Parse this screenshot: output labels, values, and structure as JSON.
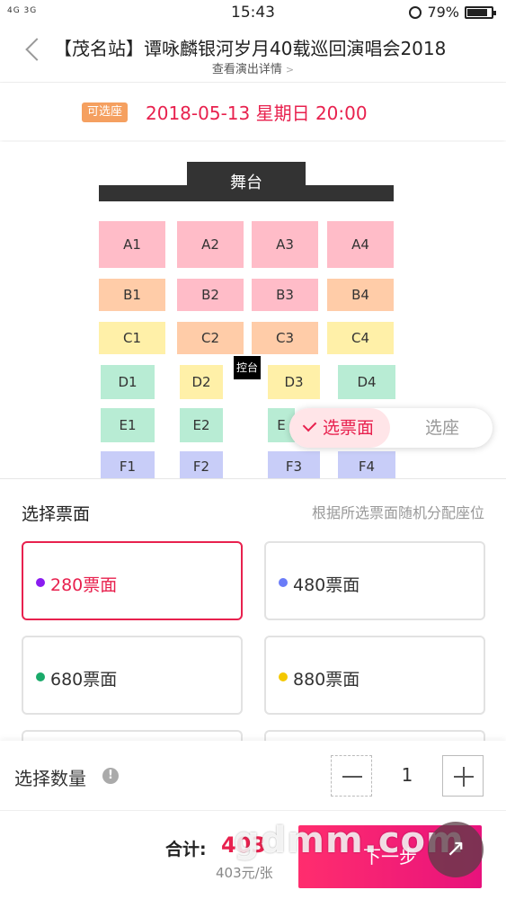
{
  "status_bar": {
    "signal": "4G 3G",
    "time": "15:43",
    "battery": "79%",
    "battery_level": 0.79
  },
  "header": {
    "title": "【茂名站】谭咏麟银河岁月40载巡回演唱会2018",
    "subtitle": "查看演出详情",
    "subtitle_chevron": ">"
  },
  "session": {
    "tag": "可选座",
    "date": "2018-05-13 星期日 20:00"
  },
  "seat_map": {
    "stage": "舞台",
    "control": "控台",
    "sections": [
      {
        "label": "A1",
        "color": "#ffbcc8"
      },
      {
        "label": "A2",
        "color": "#ffbcc8"
      },
      {
        "label": "A3",
        "color": "#ffbcc8"
      },
      {
        "label": "A4",
        "color": "#ffbcc8"
      },
      {
        "label": "B1",
        "color": "#ffcca8"
      },
      {
        "label": "B2",
        "color": "#ffbcc8"
      },
      {
        "label": "B3",
        "color": "#ffbcc8"
      },
      {
        "label": "B4",
        "color": "#ffcca8"
      },
      {
        "label": "C1",
        "color": "#fff0a8"
      },
      {
        "label": "C2",
        "color": "#ffcca8"
      },
      {
        "label": "C3",
        "color": "#ffcca8"
      },
      {
        "label": "C4",
        "color": "#fff0a8"
      },
      {
        "label": "D1",
        "color": "#b8ecd4"
      },
      {
        "label": "D2",
        "color": "#fff0a8"
      },
      {
        "label": "D3",
        "color": "#fff0a8"
      },
      {
        "label": "D4",
        "color": "#b8ecd4"
      },
      {
        "label": "E1",
        "color": "#b8ecd4"
      },
      {
        "label": "E2",
        "color": "#b8ecd4"
      },
      {
        "label": "E",
        "color": "#b8ecd4"
      },
      {
        "label": "F1",
        "color": "#c8cdf8"
      },
      {
        "label": "F2",
        "color": "#c8cdf8"
      },
      {
        "label": "F3",
        "color": "#c8cdf8"
      },
      {
        "label": "F4",
        "color": "#c8cdf8"
      }
    ]
  },
  "mode_toggle": {
    "active": "选票面",
    "other": "选座"
  },
  "ticket_panel": {
    "title": "选择票面",
    "hint": "根据所选票面随机分配座位",
    "options": [
      {
        "label": "280票面",
        "dot_color": "#8a1cf0"
      },
      {
        "label": "480票面",
        "dot_color": "#6a7cf8"
      },
      {
        "label": "680票面",
        "dot_color": "#1aaa6a"
      },
      {
        "label": "880票面",
        "dot_color": "#f4c800"
      }
    ]
  },
  "quantity": {
    "label": "选择数量",
    "info_icon": "!",
    "value": "1"
  },
  "footer": {
    "total_label": "合计:",
    "total_value": "403",
    "unit_price": "403元/张",
    "next_label": "下一步",
    "watermark": "gdmm.com",
    "float_icon": "↗"
  }
}
